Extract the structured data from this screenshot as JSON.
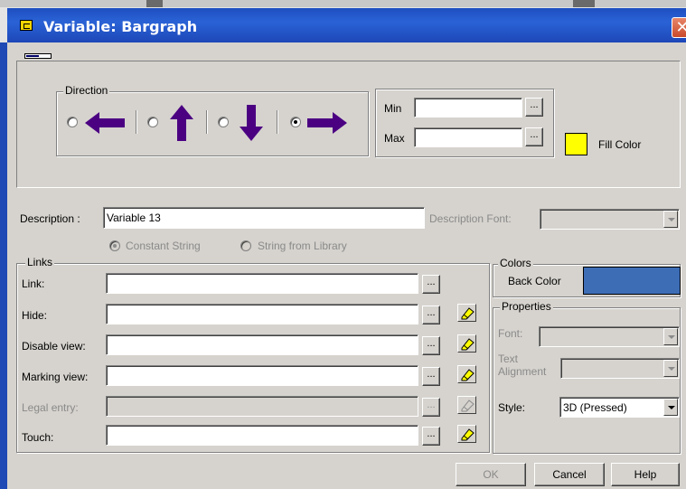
{
  "window": {
    "title": "Variable: Bargraph",
    "close_glyph": "✕"
  },
  "direction": {
    "legend": "Direction",
    "options": [
      {
        "name": "left",
        "selected": false
      },
      {
        "name": "up",
        "selected": false
      },
      {
        "name": "down",
        "selected": false
      },
      {
        "name": "right",
        "selected": true
      }
    ],
    "arrow_color": "#4b0082"
  },
  "range": {
    "min_label": "Min",
    "min_value": "",
    "max_label": "Max",
    "max_value": "",
    "browse_label": "..."
  },
  "fill_color": {
    "label": "Fill Color",
    "color": "#ffff00"
  },
  "description": {
    "label": "Description :",
    "value": "Variable 13",
    "font_label": "Description Font:",
    "font_value": "",
    "source_options": [
      {
        "label": "Constant String",
        "selected": true
      },
      {
        "label": "String from Library",
        "selected": false
      }
    ]
  },
  "links": {
    "legend": "Links",
    "rows": [
      {
        "label": "Link:",
        "value": "",
        "enabled": true,
        "has_eraser": false
      },
      {
        "label": "Hide:",
        "value": "",
        "enabled": true,
        "has_eraser": true
      },
      {
        "label": "Disable view:",
        "value": "",
        "enabled": true,
        "has_eraser": true
      },
      {
        "label": "Marking view:",
        "value": "",
        "enabled": true,
        "has_eraser": true
      },
      {
        "label": "Legal entry:",
        "value": "",
        "enabled": false,
        "has_eraser": true
      },
      {
        "label": "Touch:",
        "value": "",
        "enabled": true,
        "has_eraser": true
      }
    ],
    "browse_label": "..."
  },
  "colors": {
    "legend": "Colors",
    "back_color_label": "Back Color",
    "back_color": "#3d6db5"
  },
  "properties": {
    "legend": "Properties",
    "font_label": "Font:",
    "font_value": "",
    "text_alignment_label_1": "Text",
    "text_alignment_label_2": "Alignment",
    "text_alignment_value": "",
    "style_label": "Style:",
    "style_value": "3D (Pressed)"
  },
  "footer": {
    "ok_label": "OK",
    "cancel_label": "Cancel",
    "help_label": "Help"
  }
}
